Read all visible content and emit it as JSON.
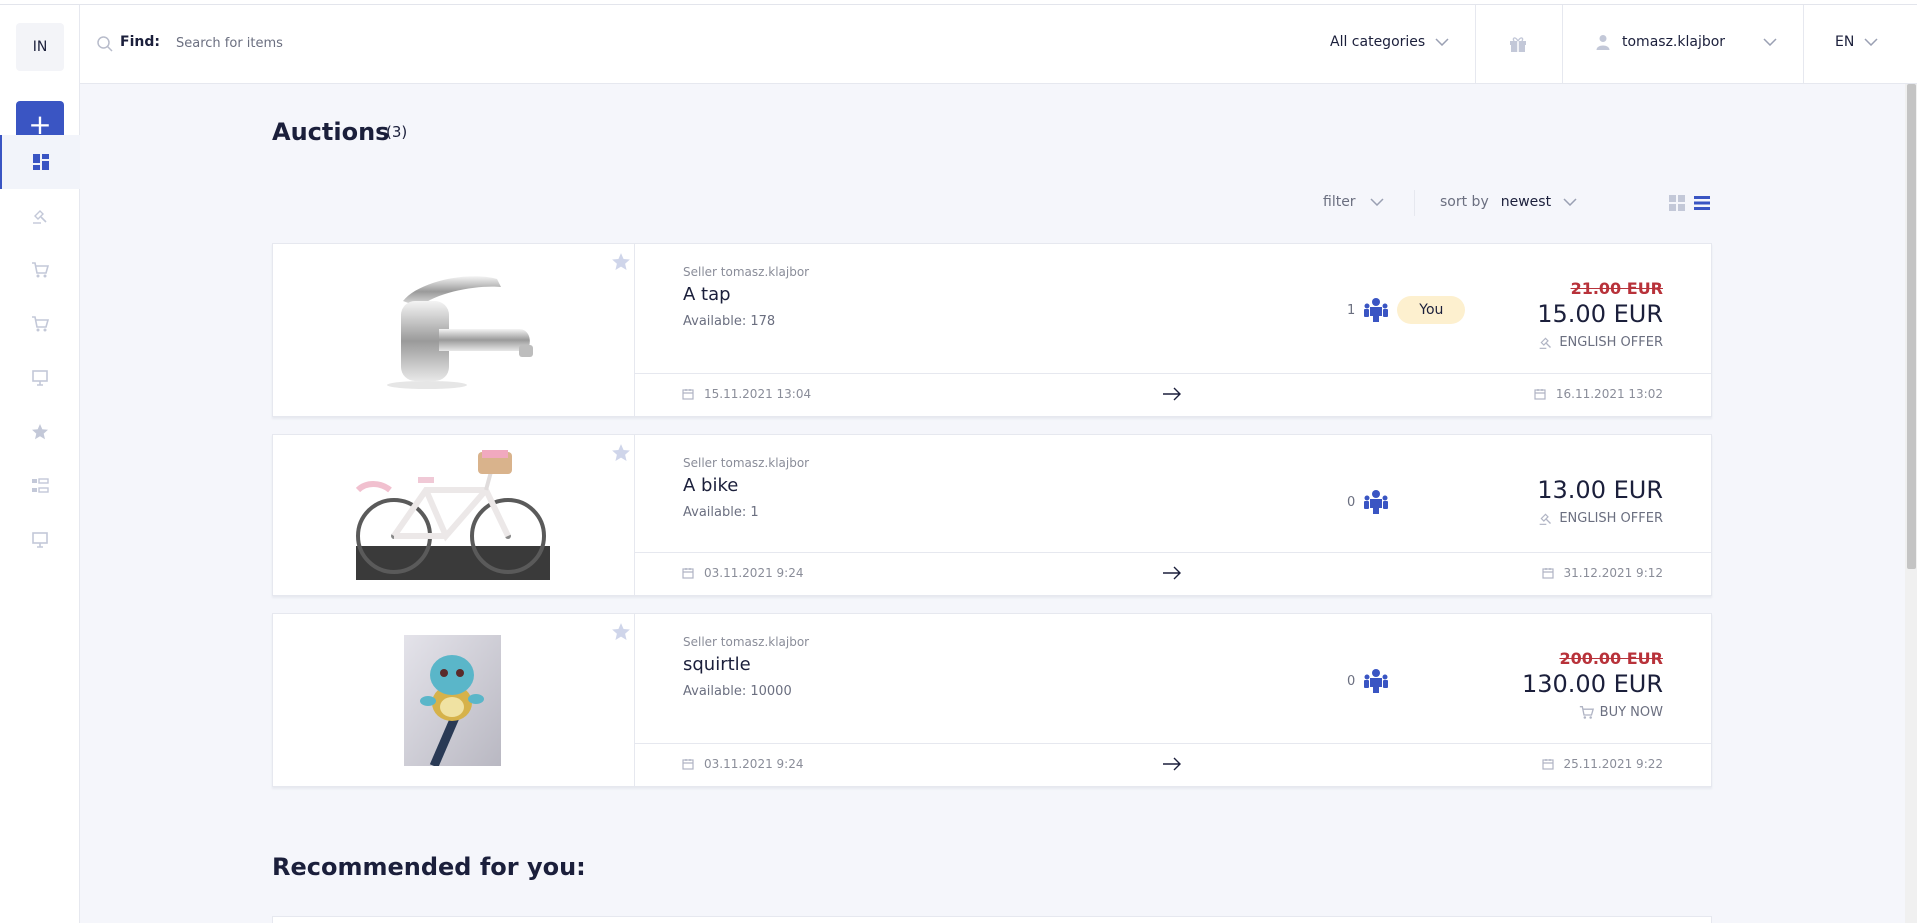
{
  "sidebar": {
    "logo_text": "IN",
    "add_label": "+",
    "items": [
      {
        "icon": "dashboard-icon",
        "active": true
      },
      {
        "icon": "gavel-icon"
      },
      {
        "icon": "cart-icon"
      },
      {
        "icon": "cart-icon"
      },
      {
        "icon": "monitor-icon"
      },
      {
        "icon": "star-icon"
      },
      {
        "icon": "list-tree-icon"
      },
      {
        "icon": "monitor-icon"
      }
    ]
  },
  "header": {
    "find_label": "Find:",
    "search_placeholder": "Search for items",
    "categories_label": "All categories",
    "username": "tomasz.klajbor",
    "language": "EN"
  },
  "main": {
    "title": "Auctions",
    "count": "(3)",
    "filter_label": "filter",
    "sort_label": "sort by",
    "sort_value": "newest",
    "auctions": [
      {
        "seller": "Seller tomasz.klajbor",
        "name": "A tap",
        "available": "Available: 178",
        "bidders": "1",
        "you_badge": "You",
        "old_price": "21.00 EUR",
        "price": "15.00 EUR",
        "offer_type": "ENGLISH OFFER",
        "start_date": "15.11.2021 13:04",
        "end_date": "16.11.2021 13:02"
      },
      {
        "seller": "Seller tomasz.klajbor",
        "name": "A bike",
        "available": "Available: 1",
        "bidders": "0",
        "price": "13.00 EUR",
        "offer_type": "ENGLISH OFFER",
        "start_date": "03.11.2021 9:24",
        "end_date": "31.12.2021 9:12"
      },
      {
        "seller": "Seller tomasz.klajbor",
        "name": "squirtle",
        "available": "Available: 10000",
        "bidders": "0",
        "old_price": "200.00 EUR",
        "price": "130.00 EUR",
        "offer_type": "BUY NOW",
        "start_date": "03.11.2021 9:24",
        "end_date": "25.11.2021 9:22"
      }
    ],
    "recommended_title": "Recommended for you:"
  },
  "colors": {
    "accent": "#3a55c3",
    "strike_price": "#b8323a",
    "you_badge_bg": "#fdf0cf",
    "page_bg": "#f5f6fb"
  }
}
